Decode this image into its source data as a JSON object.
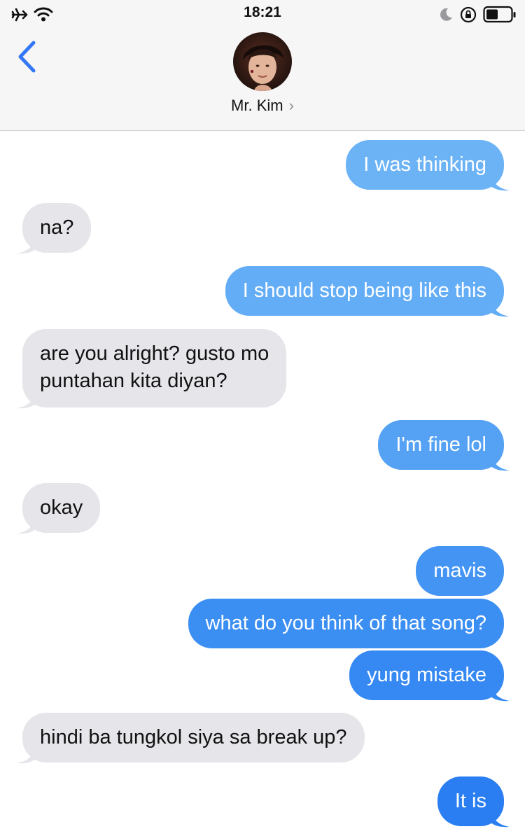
{
  "status_bar": {
    "time": "18:21",
    "icons": [
      "airplane-icon",
      "wifi-icon",
      "moon-icon",
      "orientation-lock-icon",
      "battery-icon"
    ]
  },
  "header": {
    "contact_name": "Mr. Kim",
    "chevron": "›"
  },
  "colors": {
    "sent_light": "#6cb3f6",
    "sent_mid": "#3c8cf0",
    "sent_deep": "#2a7ef1",
    "received": "#e5e5ea",
    "back_arrow": "#3478f6"
  },
  "messages": [
    {
      "direction": "sent",
      "text": "I was thinking"
    },
    {
      "direction": "received",
      "text": "na?"
    },
    {
      "direction": "sent",
      "text": "I should stop being like this"
    },
    {
      "direction": "received",
      "lines": [
        "are you alright? gusto mo",
        "puntahan kita diyan?"
      ]
    },
    {
      "direction": "sent",
      "text": "I'm fine lol"
    },
    {
      "direction": "received",
      "text": "okay"
    },
    {
      "direction": "sent",
      "text": "mavis"
    },
    {
      "direction": "sent",
      "text": "what do you think of that song?"
    },
    {
      "direction": "sent",
      "text": "yung mistake"
    },
    {
      "direction": "received",
      "text": "hindi ba tungkol siya sa break up?"
    },
    {
      "direction": "sent",
      "text": "It is"
    }
  ]
}
